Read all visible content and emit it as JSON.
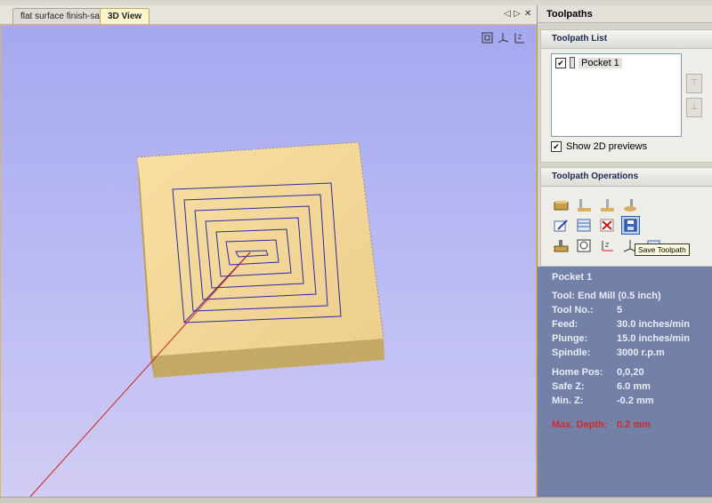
{
  "tabs": [
    {
      "label": "flat surface finish-sat"
    },
    {
      "label": "3D View"
    }
  ],
  "tab_controls": {
    "prev": "◁",
    "next": "▷",
    "close": "✕"
  },
  "view_icons": [
    "fit-view-icon",
    "axes-view-icon",
    "top-view-icon"
  ],
  "panel": {
    "title": "Toolpaths",
    "list_header": "Toolpath List",
    "items": [
      {
        "label": "Pocket 1",
        "checked": true
      }
    ],
    "show_previews_label": "Show 2D previews",
    "operations_header": "Toolpath Operations",
    "tooltip": "Save Toolpath"
  },
  "info": {
    "name": "Pocket 1",
    "tool": "Tool: End Mill (0.5 inch)",
    "tool_no_label": "Tool No.:",
    "tool_no": "5",
    "feed_label": "Feed:",
    "feed": "30.0 inches/min",
    "plunge_label": "Plunge:",
    "plunge": "15.0 inches/min",
    "spindle_label": "Spindle:",
    "spindle": "3000 r.p.m",
    "home_label": "Home Pos:",
    "home": "0,0,20",
    "safez_label": "Safe Z:",
    "safez": "6.0 mm",
    "minz_label": "Min. Z:",
    "minz": "-0.2 mm",
    "maxdepth_label": "Max. Depth:",
    "maxdepth": "0.2 mm"
  },
  "colors": {
    "accent": "#e0b84a",
    "toolpath": "#2a2aa8",
    "rapid": "#d02020",
    "warning": "#d22a2a"
  }
}
